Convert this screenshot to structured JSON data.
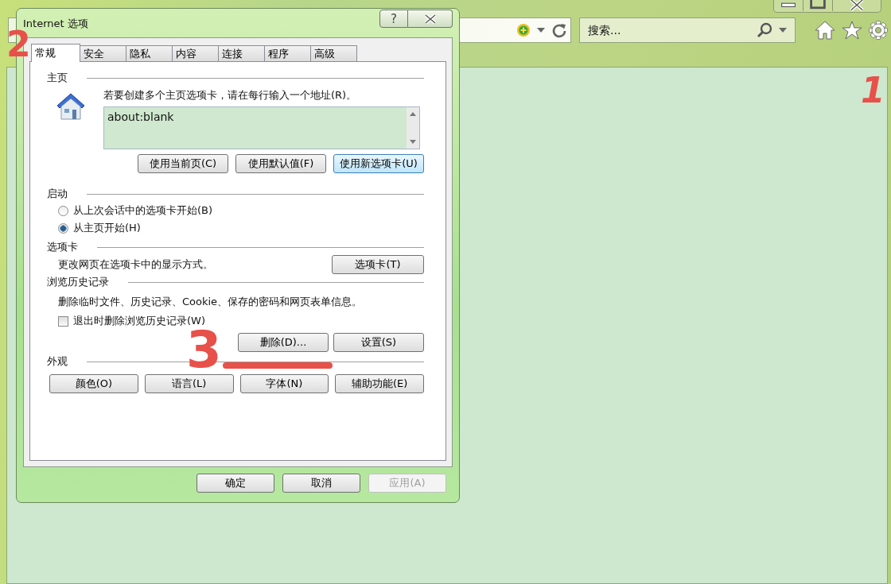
{
  "browser": {
    "search": {
      "placeholder": "搜索..."
    }
  },
  "dialog": {
    "title": "Internet 选项",
    "help_label": "?",
    "tabs": [
      {
        "label": "常规",
        "selected": true
      },
      {
        "label": "安全",
        "selected": false
      },
      {
        "label": "隐私",
        "selected": false
      },
      {
        "label": "内容",
        "selected": false
      },
      {
        "label": "连接",
        "selected": false
      },
      {
        "label": "程序",
        "selected": false
      },
      {
        "label": "高级",
        "selected": false
      }
    ],
    "sections": [
      {
        "kind": "homepage",
        "heading": "主页",
        "prompt": "若要创建多个主页选项卡，请在每行输入一个地址(R)。",
        "addresses": "about:blank",
        "buttons": [
          {
            "label": "使用当前页(C)",
            "focused": false
          },
          {
            "label": "使用默认值(F)",
            "focused": false
          },
          {
            "label": "使用新选项卡(U)",
            "focused": true
          }
        ]
      },
      {
        "kind": "startup",
        "heading": "启动",
        "options": [
          {
            "label": "从上次会话中的选项卡开始(B)",
            "selected": false
          },
          {
            "label": "从主页开始(H)",
            "selected": true
          }
        ]
      },
      {
        "kind": "tabs",
        "heading": "选项卡",
        "description": "更改网页在选项卡中的显示方式。",
        "buttons": [
          {
            "label": "选项卡(T)",
            "focused": false
          }
        ]
      },
      {
        "kind": "history",
        "heading": "浏览历史记录",
        "description": "删除临时文件、历史记录、Cookie、保存的密码和网页表单信息。",
        "checkbox": {
          "label": "退出时删除浏览历史记录(W)",
          "checked": false
        },
        "buttons": [
          {
            "label": "删除(D)...",
            "focused": false
          },
          {
            "label": "设置(S)",
            "focused": false
          }
        ]
      },
      {
        "kind": "appearance",
        "heading": "外观",
        "buttons": [
          {
            "label": "颜色(O)",
            "focused": false
          },
          {
            "label": "语言(L)",
            "focused": false
          },
          {
            "label": "字体(N)",
            "focused": false
          },
          {
            "label": "辅助功能(E)",
            "focused": false
          }
        ]
      }
    ],
    "footer_buttons": [
      {
        "label": "确定",
        "disabled": false
      },
      {
        "label": "取消",
        "disabled": false
      },
      {
        "label": "应用(A)",
        "disabled": true
      }
    ]
  },
  "annotations": [
    {
      "kind": "stroke",
      "label": "1"
    },
    {
      "kind": "digit",
      "label": "2"
    },
    {
      "kind": "digit",
      "label": "3"
    },
    {
      "kind": "underline"
    }
  ]
}
